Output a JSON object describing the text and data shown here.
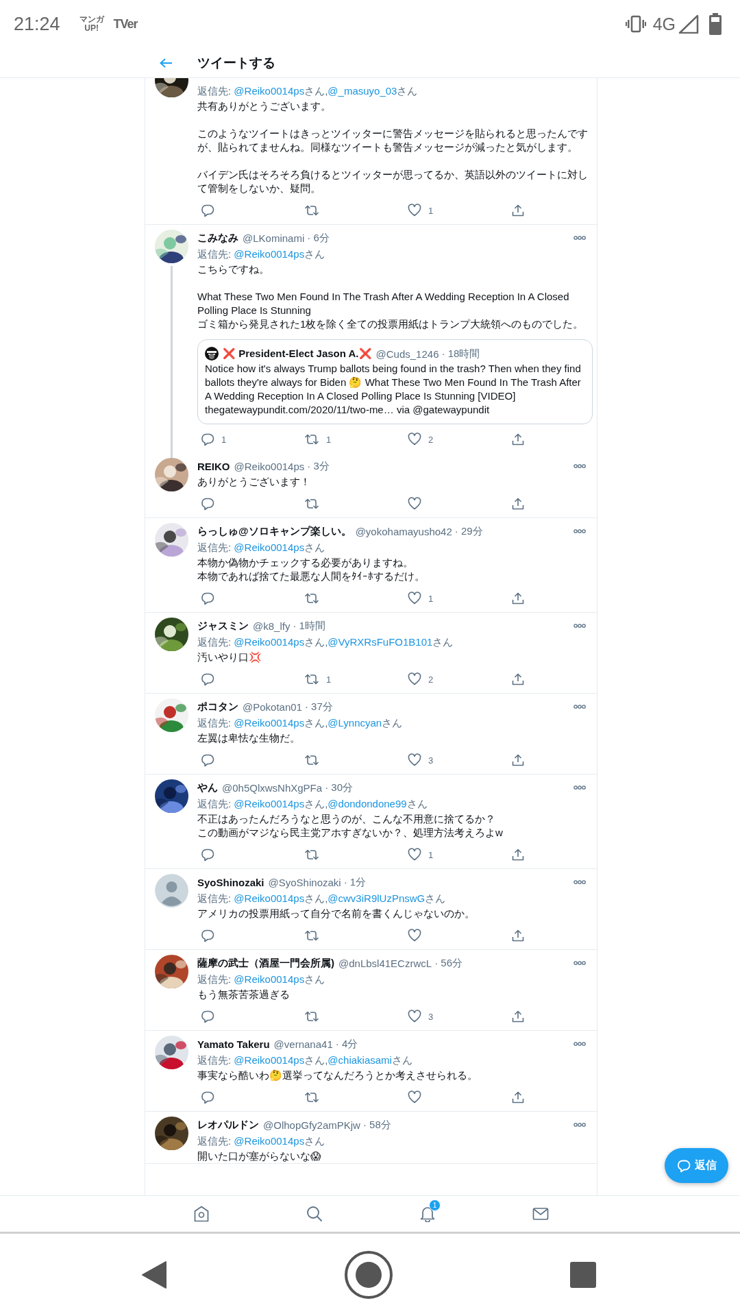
{
  "status_bar": {
    "time": "21:24",
    "notification_icons": [
      {
        "kind": "stacked",
        "lines": [
          "マンガ",
          "UP!"
        ]
      },
      {
        "kind": "plain",
        "lines": [
          "TVer"
        ]
      }
    ],
    "network": "4G"
  },
  "header": {
    "title": "ツイートする"
  },
  "tweets": [
    {
      "avatar": {
        "kind": "picture"
      },
      "thread": false,
      "reply": {
        "prefix": "返信先: ",
        "mentions": [
          {
            "handle": "@Reiko0014ps",
            "suffix": "さん,"
          },
          {
            "handle": "@_masuyo_03",
            "suffix": "さん"
          }
        ]
      },
      "paragraphs": [
        [
          "共有ありがとうございます。"
        ],
        [
          "このようなツイートはきっとツイッターに警告メッセージを貼られると思ったんですが、貼られてませんね。同様なツイートも警告メッセージが減ったと気がします。"
        ],
        [
          "バイデン氏はそろそろ負けるとツイッターが思ってるか、英語以外のツイートに対して管制をしないか、疑問。"
        ]
      ],
      "actions": [
        {
          "kind": "reply"
        },
        {
          "kind": "retweet"
        },
        {
          "kind": "like",
          "count": "1"
        },
        {
          "kind": "share"
        }
      ]
    },
    {
      "avatar": {
        "kind": "picture"
      },
      "name": "こみなみ",
      "handle": "@LKominami",
      "time": "· 6分",
      "thread": true,
      "reply": {
        "prefix": "返信先: ",
        "mentions": [
          {
            "handle": "@Reiko0014ps",
            "suffix": "さん"
          }
        ]
      },
      "paragraphs": [
        [
          "こちらですね。"
        ],
        [
          "What These Two Men Found In The Trash After A Wedding Reception In A Closed Polling Place Is Stunning",
          "ゴミ箱から発見された1枚を除く全ての投票用紙はトランプ大統領へのものでした。"
        ]
      ],
      "quote": {
        "name": "❌ President-Elect Jason A.❌",
        "handle": "@Cuds_1246",
        "time": "· 18時間",
        "text": "Notice how it's always Trump ballots being found in the trash? Then when they find ballots they're always for Biden 🤔  What These Two Men Found In The Trash After A Wedding Reception In A Closed Polling Place Is Stunning [VIDEO] thegatewaypundit.com/2020/11/two-me… via @gatewaypundit"
      },
      "actions": [
        {
          "kind": "reply",
          "count": "1"
        },
        {
          "kind": "retweet",
          "count": "1"
        },
        {
          "kind": "like",
          "count": "2"
        },
        {
          "kind": "share"
        }
      ]
    },
    {
      "avatar": {
        "kind": "picture"
      },
      "name": "REIKO",
      "handle": "@Reiko0014ps",
      "time": "· 3分",
      "thread": false,
      "paragraphs": [
        [
          "ありがとうございます！"
        ]
      ],
      "actions": [
        {
          "kind": "reply"
        },
        {
          "kind": "retweet"
        },
        {
          "kind": "like"
        },
        {
          "kind": "share"
        }
      ]
    },
    {
      "avatar": {
        "kind": "picture"
      },
      "name": "らっしゅ@ソロキャンプ楽しい。",
      "handle": "@yokohamayusho42",
      "time": "· 29分",
      "thread": false,
      "reply": {
        "prefix": "返信先: ",
        "mentions": [
          {
            "handle": "@Reiko0014ps",
            "suffix": "さん"
          }
        ]
      },
      "paragraphs": [
        [
          "本物か偽物かチェックする必要がありますね。",
          "本物であれば捨てた最悪な人間をﾀｲｰﾎするだけ。"
        ]
      ],
      "actions": [
        {
          "kind": "reply"
        },
        {
          "kind": "retweet"
        },
        {
          "kind": "like",
          "count": "1"
        },
        {
          "kind": "share"
        }
      ]
    },
    {
      "avatar": {
        "kind": "picture"
      },
      "name": "ジャスミン",
      "handle": "@k8_lfy",
      "time": "· 1時間",
      "thread": false,
      "reply": {
        "prefix": "返信先: ",
        "mentions": [
          {
            "handle": "@Reiko0014ps",
            "suffix": "さん,"
          },
          {
            "handle": "@VyRXRsFuFO1B101",
            "suffix": "さん"
          }
        ]
      },
      "paragraphs": [
        [
          "汚いやり口💢"
        ]
      ],
      "actions": [
        {
          "kind": "reply"
        },
        {
          "kind": "retweet",
          "count": "1"
        },
        {
          "kind": "like",
          "count": "2"
        },
        {
          "kind": "share"
        }
      ]
    },
    {
      "avatar": {
        "kind": "picture"
      },
      "name": "ポコタン",
      "handle": "@Pokotan01",
      "time": "· 37分",
      "thread": false,
      "reply": {
        "prefix": "返信先: ",
        "mentions": [
          {
            "handle": "@Reiko0014ps",
            "suffix": "さん,"
          },
          {
            "handle": "@Lynncyan",
            "suffix": "さん"
          }
        ]
      },
      "paragraphs": [
        [
          "左翼は卑怯な生物だ。"
        ]
      ],
      "actions": [
        {
          "kind": "reply"
        },
        {
          "kind": "retweet"
        },
        {
          "kind": "like",
          "count": "3"
        },
        {
          "kind": "share"
        }
      ]
    },
    {
      "avatar": {
        "kind": "picture"
      },
      "name": "やん",
      "handle": "@0h5QlxwsNhXgPFa",
      "time": "· 30分",
      "thread": false,
      "reply": {
        "prefix": "返信先: ",
        "mentions": [
          {
            "handle": "@Reiko0014ps",
            "suffix": "さん,"
          },
          {
            "handle": "@dondondone99",
            "suffix": "さん"
          }
        ]
      },
      "paragraphs": [
        [
          "不正はあったんだろうなと思うのが、こんな不用意に捨てるか？",
          "この動画がマジなら民主党アホすぎないか？、処理方法考えろよw"
        ]
      ],
      "actions": [
        {
          "kind": "reply"
        },
        {
          "kind": "retweet"
        },
        {
          "kind": "like",
          "count": "1"
        },
        {
          "kind": "share"
        }
      ]
    },
    {
      "avatar": {
        "kind": "default"
      },
      "name": "SyoShinozaki",
      "handle": "@SyoShinozaki",
      "time": "· 1分",
      "thread": false,
      "reply": {
        "prefix": "返信先: ",
        "mentions": [
          {
            "handle": "@Reiko0014ps",
            "suffix": "さん,"
          },
          {
            "handle": "@cwv3iR9lUzPnswG",
            "suffix": "さん"
          }
        ]
      },
      "paragraphs": [
        [
          "アメリカの投票用紙って自分で名前を書くんじゃないのか。"
        ]
      ],
      "actions": [
        {
          "kind": "reply"
        },
        {
          "kind": "retweet"
        },
        {
          "kind": "like"
        },
        {
          "kind": "share"
        }
      ]
    },
    {
      "avatar": {
        "kind": "picture"
      },
      "name": "薩摩の武士（酒屋一門会所属)",
      "handle": "@dnLbsl41ECzrwcL",
      "time": "· 56分",
      "thread": false,
      "reply": {
        "prefix": "返信先: ",
        "mentions": [
          {
            "handle": "@Reiko0014ps",
            "suffix": "さん"
          }
        ]
      },
      "paragraphs": [
        [
          "もう無茶苦茶過ぎる"
        ]
      ],
      "actions": [
        {
          "kind": "reply"
        },
        {
          "kind": "retweet"
        },
        {
          "kind": "like",
          "count": "3"
        },
        {
          "kind": "share"
        }
      ]
    },
    {
      "avatar": {
        "kind": "picture"
      },
      "name": "Yamato Takeru",
      "handle": "@vernana41",
      "time": "· 4分",
      "thread": false,
      "reply": {
        "prefix": "返信先: ",
        "mentions": [
          {
            "handle": "@Reiko0014ps",
            "suffix": "さん,"
          },
          {
            "handle": "@chiakiasami",
            "suffix": "さん"
          }
        ]
      },
      "paragraphs": [
        [
          "事実なら酷いわ🤔選挙ってなんだろうとか考えさせられる。"
        ]
      ],
      "actions": [
        {
          "kind": "reply"
        },
        {
          "kind": "retweet"
        },
        {
          "kind": "like"
        },
        {
          "kind": "share"
        }
      ]
    },
    {
      "avatar": {
        "kind": "picture"
      },
      "name": "レオパルドン",
      "handle": "@OlhopGfy2amPKjw",
      "time": "· 58分",
      "thread": false,
      "reply": {
        "prefix": "返信先: ",
        "mentions": [
          {
            "handle": "@Reiko0014ps",
            "suffix": "さん"
          }
        ]
      },
      "paragraphs": [
        [
          "開いた口が塞がらないな😱"
        ]
      ]
    }
  ],
  "reply_fab": {
    "label": "返信"
  },
  "bottom_nav": [
    {
      "kind": "home",
      "selected": false
    },
    {
      "kind": "search",
      "selected": false
    },
    {
      "kind": "notifications",
      "selected": false,
      "badge": "1"
    },
    {
      "kind": "messages",
      "selected": false
    }
  ]
}
